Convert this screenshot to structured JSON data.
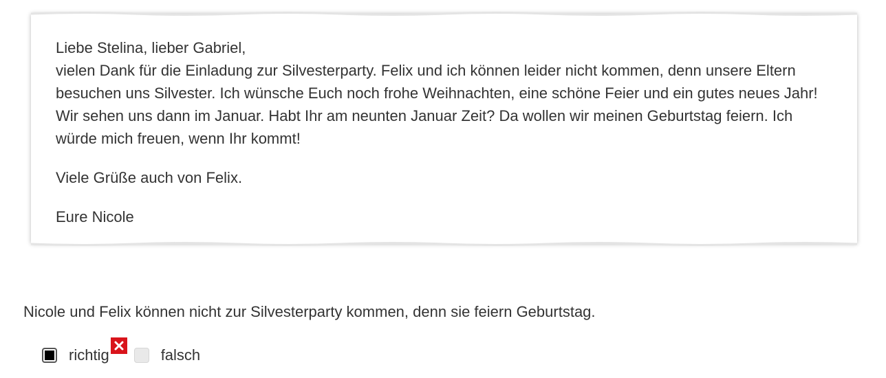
{
  "letter": {
    "greeting": "Liebe Stelina, lieber Gabriel,",
    "body": "vielen Dank für die Einladung zur Silvesterparty. Felix und ich können leider nicht kommen, denn unsere Eltern besuchen uns Silvester. Ich wünsche Euch noch frohe Weihnachten, eine schöne Feier und ein gutes neues Jahr! Wir sehen uns dann im Januar. Habt Ihr am neunten Januar Zeit? Da wollen wir meinen Geburtstag feiern. Ich würde mich freuen, wenn Ihr kommt!",
    "regards": "Viele Grüße auch von Felix.",
    "signature": "Eure Nicole"
  },
  "question": {
    "statement": "Nicole und Felix können nicht zur Silvesterparty kommen, denn sie feiern Geburtstag.",
    "options": [
      {
        "label": "richtig",
        "selected": true,
        "marked_wrong": true
      },
      {
        "label": "falsch",
        "selected": false,
        "marked_wrong": false
      }
    ]
  },
  "colors": {
    "text": "#333333",
    "wrong_mark": "#d9141b",
    "checkbox_fill": "#000000",
    "checkbox_unchecked": "#e9e9e9"
  },
  "icons": {
    "wrong_mark": "wrong-answer-icon"
  }
}
